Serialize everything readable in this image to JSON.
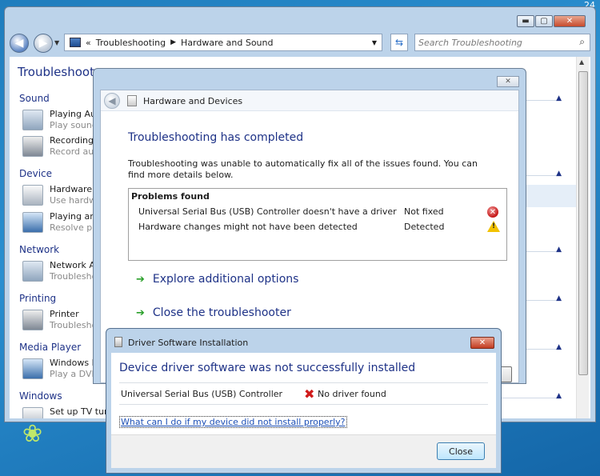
{
  "desktop": {
    "clock_fragment": "24"
  },
  "main_window": {
    "caption": {
      "minimize": "▬",
      "maximize": "▢",
      "close": "✕"
    },
    "breadcrumb": {
      "prefix": "«",
      "items": [
        "Troubleshooting",
        "Hardware and Sound"
      ]
    },
    "search_placeholder": "Search Troubleshooting",
    "page_title": "Troubleshoot p",
    "categories": [
      {
        "label": "Sound",
        "items": [
          {
            "title": "Playing Aud",
            "subtitle": "Play sound"
          },
          {
            "title": "Recording a",
            "subtitle": "Record aud"
          }
        ]
      },
      {
        "label": "Device",
        "items": [
          {
            "title": "Hardware a",
            "subtitle": "Use hardwa"
          },
          {
            "title": "Playing and",
            "subtitle": "Resolve pro"
          }
        ]
      },
      {
        "label": "Network",
        "items": [
          {
            "title": "Network Ac",
            "subtitle": "Troublesho"
          }
        ]
      },
      {
        "label": "Printing",
        "items": [
          {
            "title": "Printer",
            "subtitle": "Troublesho"
          }
        ]
      },
      {
        "label": "Media Player",
        "items": [
          {
            "title": "Windows M",
            "subtitle": "Play a DVD"
          }
        ]
      },
      {
        "label": "Windows",
        "items": [
          {
            "title": "Set up TV tune",
            "subtitle": ""
          }
        ]
      }
    ]
  },
  "troubleshooter": {
    "header_title": "Hardware and Devices",
    "close_label": "✕",
    "title": "Troubleshooting has completed",
    "description": "Troubleshooting was unable to automatically fix all of the issues found. You can find more details below.",
    "problems_title": "Problems found",
    "problems": [
      {
        "name": "Universal Serial Bus (USB) Controller doesn't have a driver",
        "status": "Not fixed",
        "icon": "error-icon"
      },
      {
        "name": "Hardware changes might not have been detected",
        "status": "Detected",
        "icon": "warning-icon"
      }
    ],
    "options": [
      {
        "label": "Explore additional options"
      },
      {
        "label": "Close the troubleshooter"
      }
    ]
  },
  "driver_dialog": {
    "caption": "Driver Software Installation",
    "title": "Device driver software was not successfully installed",
    "device": "Universal Serial Bus (USB) Controller",
    "status": "No driver found",
    "link": "What can I do if my device did not install properly?",
    "close_button": "Close"
  }
}
